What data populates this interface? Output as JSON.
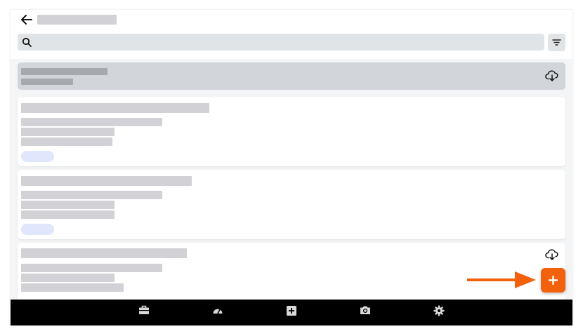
{
  "screen": {
    "back_icon": "arrow-left-icon",
    "title": "",
    "search": {
      "placeholder": "",
      "value": "",
      "icon": "search-icon"
    },
    "filter_icon": "filter-icon"
  },
  "sync_banner": {
    "icon": "cloud-download-icon"
  },
  "cards": [
    {
      "status": "pill-blue"
    },
    {
      "status": "pill-blue"
    },
    {
      "status": "pill-red",
      "icon": "cloud-download-icon"
    }
  ],
  "fab": {
    "icon": "plus-icon"
  },
  "bottom_nav": [
    {
      "icon": "briefcase-icon"
    },
    {
      "icon": "speedometer-icon"
    },
    {
      "icon": "plus-square-icon"
    },
    {
      "icon": "camera-icon"
    },
    {
      "icon": "gear-icon"
    }
  ],
  "colors": {
    "accent": "#f4610d",
    "bottom_nav": "#000000",
    "placeholder": "#d1d1d6",
    "pill_blue": "#e0e6fb"
  }
}
